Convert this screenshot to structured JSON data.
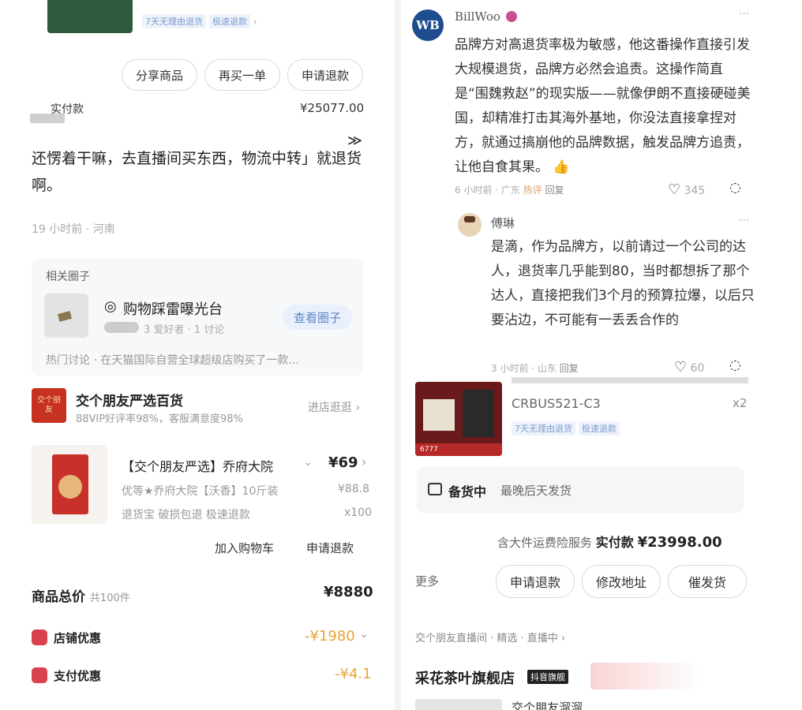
{
  "left_top": {
    "returns_tags": [
      "7天无理由退货",
      "极速退款"
    ],
    "buttons": {
      "share": "分享商品",
      "rebuy": "再买一单",
      "refund": "申请退款"
    },
    "paid_label": "实付款",
    "paid_value": "¥25077.00",
    "comment": "还愣着干嘛，去直播间买东西，物流中转」就退货啊。",
    "comment_meta": "19 小时前 · 河南"
  },
  "circle": {
    "section_label": "相关圈子",
    "name": "购物踩雷曝光台",
    "stats": "3 爱好者 · 1 讨论",
    "view_button": "查看圈子",
    "hot": "热门讨论 · 在天猫国际自营全球超级店购买了一款..."
  },
  "shop_left": {
    "name": "交个朋友严选百货",
    "rating": "88VIP好评率98%，客服满意度98%",
    "enter": "进店逛逛",
    "logo_text": "交个朋友"
  },
  "product_left": {
    "title": "【交个朋友严选】乔府大院",
    "price": "¥69",
    "spec": "优等★乔府大院【沃香】10斤装",
    "orig_price": "¥88.8",
    "service_tags": "退货宝 破损包退 极速退款",
    "qty": "x100",
    "add_cart": "加入购物车",
    "refund": "申请退款"
  },
  "totals": {
    "goods_label": "商品总价",
    "goods_count": "共100件",
    "goods_value": "¥8880",
    "shop_discount_label": "店铺优惠",
    "shop_discount_value": "-¥1980",
    "pay_discount_label": "支付优惠",
    "pay_discount_value": "-¥4.1"
  },
  "comments_right": {
    "c1": {
      "user": "BillWoo",
      "text": "品牌方对高退货率极为敏感，他这番操作直接引发大规模退货，品牌方必然会追责。这操作简直是“围魏救赵”的现实版——就像伊朗不直接硬碰美国，却精准打击其海外基地，你没法直接拿捏对方，就通过搞崩他的品牌数据，触发品牌方追责，让他自食其果。",
      "emoji": "👍",
      "meta": "6 小时前 · 广东",
      "hot": "热评",
      "reply": "回复",
      "likes": "345"
    },
    "c2": {
      "user": "傅琳",
      "text": "是滴，作为品牌方，以前请过一个公司的达人，退货率几乎能到80，当时都想拆了那个达人，直接把我们3个月的预算拉爆，以后只要沾边，不可能有一丢丢合作的",
      "meta": "3 小时前 · 山东",
      "reply": "回复",
      "likes": "60"
    }
  },
  "order_right": {
    "sku": "CRBUS521-C3",
    "qty": "x2",
    "tags": [
      "7天无理由退货",
      "极速退款"
    ],
    "thumb_label": "6777",
    "status_label": "备货中",
    "status_detail": "最晚后天发货",
    "service_note": "含大件运费险服务",
    "paid_label": "实付款",
    "paid_value": "¥23998.00",
    "more": "更多",
    "buttons": {
      "refund": "申请退款",
      "address": "修改地址",
      "urge": "催发货"
    }
  },
  "shop_right": {
    "breadcrumb": "交个朋友直播间 · 精选 · 直播中",
    "name": "采花茶叶旗舰店",
    "badge": "抖音旗舰",
    "product": "交个朋友溜溜"
  },
  "colors": {
    "red": "#e2231a",
    "orange": "#e8a33a",
    "link": "#7a9bd0"
  }
}
